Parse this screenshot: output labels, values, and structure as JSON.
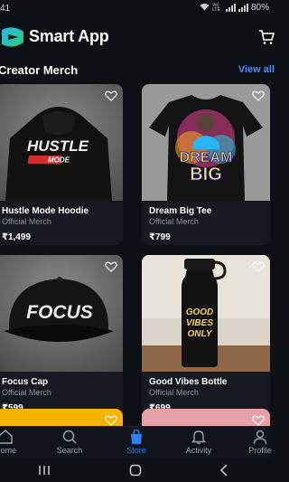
{
  "status": {
    "time": "41",
    "net": "Vo) LTE",
    "battery": "80%"
  },
  "app": {
    "title": "Smart App"
  },
  "section": {
    "title": "Creator Merch",
    "view_all": "View all"
  },
  "products": [
    {
      "name": "Hustle Mode Hoodie",
      "label": "Official Merch",
      "price": "₹1,499",
      "art": [
        "HUSTLE",
        "MODE"
      ]
    },
    {
      "name": "Dream Big Tee",
      "label": "Official Merch",
      "price": "₹799",
      "art": [
        "DREAM",
        "BIG"
      ]
    },
    {
      "name": "Focus Cap",
      "label": "Official Merch",
      "price": "₹599",
      "art": [
        "FOCUS"
      ]
    },
    {
      "name": "Good Vibes Bottle",
      "label": "Official Merch",
      "price": "₹699",
      "art": [
        "GOOD",
        "VIBES",
        "ONLY"
      ]
    }
  ],
  "nav": [
    {
      "label": "Home"
    },
    {
      "label": "Search"
    },
    {
      "label": "Store"
    },
    {
      "label": "Activity"
    },
    {
      "label": "Profile"
    }
  ],
  "colors": {
    "accent": "#2f80ed",
    "link": "#4d8cff",
    "background": "#0d1014",
    "card": "#171b21"
  }
}
